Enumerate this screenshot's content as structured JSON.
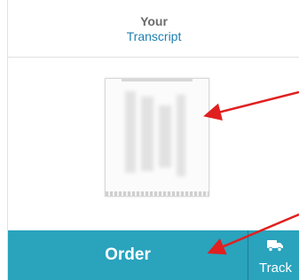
{
  "header": {
    "line1": "Your",
    "line2": "Transcript"
  },
  "preview": {
    "label": ""
  },
  "actions": {
    "order_label": "Order",
    "track_label": "Track"
  },
  "colors": {
    "accent": "#2aa3bd",
    "link": "#1f80b3",
    "annotation_arrow": "#e02020"
  },
  "icons": {
    "track": "truck-icon"
  }
}
